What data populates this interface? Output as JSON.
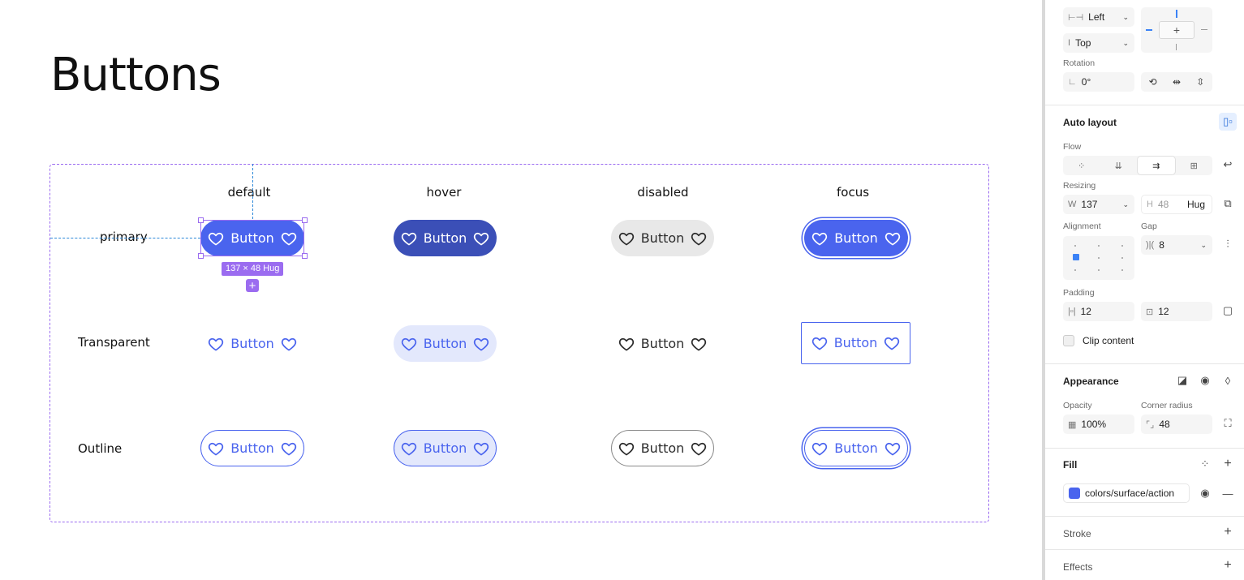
{
  "page": {
    "title": "Buttons"
  },
  "columns": [
    "default",
    "hover",
    "disabled",
    "focus"
  ],
  "rows": [
    "primary",
    "Transparent",
    "Outline"
  ],
  "button_label": "Button",
  "selection": {
    "size_badge": "137 × 48 Hug"
  },
  "colors": {
    "accent": "#4a64ee",
    "hover_dark": "#3b4fb7",
    "selection": "#9b6cf0",
    "guide": "#2c88d9"
  },
  "panel": {
    "constraints": {
      "horizontal": "Left",
      "vertical": "Top"
    },
    "rotation": {
      "label": "Rotation",
      "value": "0°"
    },
    "auto_layout": {
      "title": "Auto layout",
      "flow_label": "Flow",
      "resizing_label": "Resizing",
      "width_prefix": "W",
      "width": "137",
      "height_prefix": "H",
      "height": "48",
      "height_mode": "Hug",
      "alignment_label": "Alignment",
      "gap_label": "Gap",
      "gap": "8",
      "padding_label": "Padding",
      "padding_h": "12",
      "padding_v": "12",
      "clip_content": "Clip content"
    },
    "appearance": {
      "title": "Appearance",
      "opacity_label": "Opacity",
      "opacity": "100%",
      "radius_label": "Corner radius",
      "radius": "48"
    },
    "fill": {
      "title": "Fill",
      "style": "colors/surface/action",
      "swatch": "#4a64ee"
    },
    "stroke": {
      "title": "Stroke"
    },
    "effects": {
      "title": "Effects"
    }
  }
}
